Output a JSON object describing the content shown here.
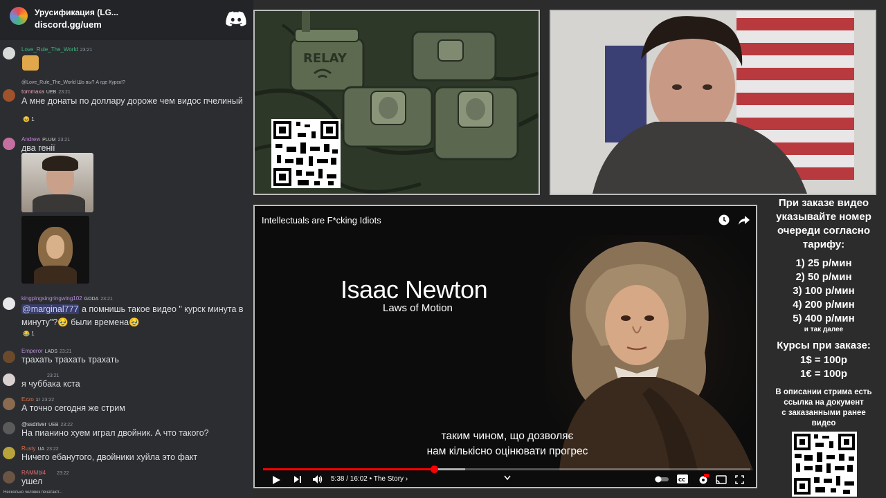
{
  "discord": {
    "server_name": "Урусификация (LG...",
    "invite": "discord.gg/uem",
    "messages": [
      {
        "user": "Love_Rule_The_World",
        "user_color": "#43b581",
        "time": "23:21",
        "text": ""
      },
      {
        "reply": "@Love_Rule_The_World Шо вы? А где Курск!?",
        "user": "tommaxa",
        "tag": "UEB",
        "user_color": "#e8a0b3",
        "time": "23:21",
        "text": "А мне донаты по доллару дороже чем видос пчелиный",
        "reaction": "1"
      },
      {
        "user": "Andrew",
        "tag": "PLUM",
        "user_color": "#c784d8",
        "time": "23:21",
        "text": "два генії"
      },
      {
        "user": "kingpingsingringwing102",
        "tag": "GODA",
        "user_color": "#b68dd9",
        "time": "23:21",
        "mention": "@marginal777",
        "text": " а помнишь такое видео \" курск минута в минуту\"?🥹 были времена🥹",
        "reaction": "1"
      },
      {
        "user": "Emperor",
        "tag": "LADS",
        "user_color": "#b68dd9",
        "time": "23:21",
        "text": "трахать трахать трахать"
      },
      {
        "user": "",
        "user_color": "#b5bac1",
        "time": "23:21",
        "text": "я чуббака кста"
      },
      {
        "user": "Ezzo",
        "tag": "1!",
        "user_color": "#e06c3a",
        "time": "23:22",
        "text": "А точно сегодня же стрим"
      },
      {
        "user": "@ssdriver",
        "tag": "UEB",
        "user_color": "#dbdee1",
        "time": "23:22",
        "text": "На пианино хуем играл двойник. А что такого?"
      },
      {
        "user": "Rusty",
        "tag": "UA",
        "user_color": "#e06c3a",
        "time": "23:22",
        "text": "Ничего ебанутого, двойники хуйла это факт"
      },
      {
        "user": "RAMMbl4",
        "user_color": "#e06c6c",
        "time": "23:22",
        "text": "ушел"
      }
    ],
    "typing": "Несколько человек печатают..."
  },
  "video": {
    "title": "Intellectuals are F*cking Idiots",
    "heading": "Isaac Newton",
    "subheading": "Laws of Motion",
    "subtitle_line1": "таким чином, що дозволяє",
    "subtitle_line2": "нам кількісно оцінювати прогрес",
    "time": "5:38 / 16:02",
    "chapter": "• The Story ›",
    "played_fraction": 0.352,
    "loaded_fraction": 0.415
  },
  "relay_label": "RELAY",
  "info": {
    "intro": [
      "При заказе видео",
      "указывайте номер",
      "очереди согласно",
      "тарифу:"
    ],
    "tariffs": [
      "1) 25 р/мин",
      "2) 50 р/мин",
      "3) 100 р/мин",
      "4) 200 р/мин",
      "5) 400 р/мин"
    ],
    "etc": "и так далее",
    "rates_title": "Курсы при заказе:",
    "rates": [
      "1$ = 100р",
      "1€ = 100р"
    ],
    "doc_note": [
      "В описании стрима есть",
      "ссылка на документ",
      "с заказанными ранее",
      "видео"
    ]
  },
  "colors": {
    "discord_bg": "#2b2d31",
    "accent_red": "#ff0000",
    "panel_border": "#bdbdbd"
  }
}
